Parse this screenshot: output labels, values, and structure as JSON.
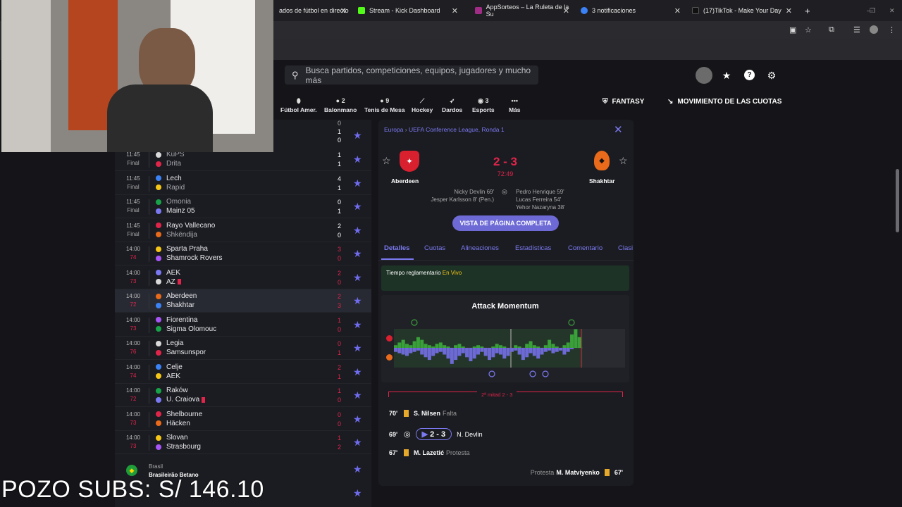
{
  "browser": {
    "tabs": [
      {
        "label": "ados de fútbol en directo",
        "color": "#1f1f23"
      },
      {
        "label": "Stream - Kick Dashboard",
        "color": "#53fc18"
      },
      {
        "label": "AppSorteos – La Ruleta de la Su",
        "color": "#a12c86"
      },
      {
        "label": "3 notificaciones",
        "color": "#3b82f6"
      },
      {
        "label": "(17)TikTok - Make Your Day",
        "color": "#111111"
      }
    ],
    "new_tab": "+"
  },
  "header": {
    "search_placeholder": "Busca partidos, competiciones, equipos, jugadores y mucho más",
    "sports": [
      {
        "label": "Fútbol Amer.",
        "count": ""
      },
      {
        "label": "Balonmano",
        "count": "2"
      },
      {
        "label": "Tenis de Mesa",
        "count": "9"
      },
      {
        "label": "Hockey",
        "count": ""
      },
      {
        "label": "Dardos",
        "count": ""
      },
      {
        "label": "Esports",
        "count": "3"
      },
      {
        "label": "Más",
        "count": ""
      }
    ],
    "fantasy": "FANTASY",
    "odds_movement": "MOVIMIENTO DE LAS CUOTAS"
  },
  "list": {
    "top_partial": {
      "home_score": "0",
      "score1": "1",
      "score2": "0"
    },
    "matches": [
      {
        "time": "11:45",
        "status": "Final",
        "live": false,
        "home": "KuPS",
        "away": "Drita",
        "hs": "1",
        "as": "1",
        "home_dim": true,
        "away_dim": true
      },
      {
        "time": "11:45",
        "status": "Final",
        "live": false,
        "home": "Lech",
        "away": "Rapid",
        "hs": "4",
        "as": "1",
        "home_dim": false,
        "away_dim": true
      },
      {
        "time": "11:45",
        "status": "Final",
        "live": false,
        "home": "Omonia",
        "away": "Mainz 05",
        "hs": "0",
        "as": "1",
        "home_dim": true,
        "away_dim": false
      },
      {
        "time": "11:45",
        "status": "Final",
        "live": false,
        "home": "Rayo Vallecano",
        "away": "Shkëndija",
        "hs": "2",
        "as": "0",
        "home_dim": false,
        "away_dim": true
      },
      {
        "time": "14:00",
        "status": "74",
        "live": true,
        "home": "Sparta Praha",
        "away": "Shamrock Rovers",
        "hs": "3",
        "as": "0",
        "home_dim": false,
        "away_dim": false
      },
      {
        "time": "14:00",
        "status": "73",
        "live": true,
        "home": "AEK",
        "away": "AZ",
        "hs": "2",
        "as": "0",
        "home_dim": false,
        "away_dim": false,
        "away_card": true
      },
      {
        "time": "14:00",
        "status": "72",
        "live": true,
        "home": "Aberdeen",
        "away": "Shakhtar",
        "hs": "2",
        "as": "3",
        "home_dim": false,
        "away_dim": false,
        "selected": true
      },
      {
        "time": "14:00",
        "status": "73",
        "live": true,
        "home": "Fiorentina",
        "away": "Sigma Olomouc",
        "hs": "1",
        "as": "0",
        "home_dim": false,
        "away_dim": false
      },
      {
        "time": "14:00",
        "status": "76",
        "live": true,
        "home": "Legia",
        "away": "Samsunspor",
        "hs": "0",
        "as": "1",
        "home_dim": false,
        "away_dim": false
      },
      {
        "time": "14:00",
        "status": "74",
        "live": true,
        "home": "Celje",
        "away": "AEK",
        "hs": "2",
        "as": "1",
        "home_dim": false,
        "away_dim": false
      },
      {
        "time": "14:00",
        "status": "72",
        "live": true,
        "home": "Raków",
        "away": "U. Craiova",
        "hs": "1",
        "as": "0",
        "home_dim": false,
        "away_dim": false,
        "away_card": true
      },
      {
        "time": "14:00",
        "status": "73",
        "live": true,
        "home": "Shelbourne",
        "away": "Häcken",
        "hs": "0",
        "as": "0",
        "home_dim": false,
        "away_dim": false
      },
      {
        "time": "14:00",
        "status": "73",
        "live": true,
        "home": "Slovan",
        "away": "Strasbourg",
        "hs": "1",
        "as": "2",
        "home_dim": false,
        "away_dim": false
      }
    ],
    "next_league": {
      "country": "Brasil",
      "name": "Brasileirão Betano"
    }
  },
  "detail": {
    "breadcrumb_region": "Europa",
    "breadcrumb_comp": "UEFA Conference League, Ronda 1",
    "home": "Aberdeen",
    "away": "Shakhtar",
    "score": "2 - 3",
    "clock": "72:49",
    "home_scorers": [
      "Nicky Devlin 69'",
      "Jesper Karlsson 8' (Pen.)"
    ],
    "away_scorers": [
      "Pedro Henrique 59'",
      "Lucas Ferreira 54'",
      "Yehor Nazaryna 38'"
    ],
    "full_page_button": "VISTA DE PÁGINA COMPLETA",
    "tabs": [
      "Detalles",
      "Cuotas",
      "Alineaciones",
      "Estadísticas",
      "Comentario",
      "Clasi"
    ],
    "status_label": "Tiempo reglamentario",
    "status_value": "En Vivo",
    "momentum_title": "Attack Momentum",
    "half_label": "2ª mitad 2 - 3",
    "events": [
      {
        "minute": "70'",
        "player": "S. Nilsen",
        "detail": "Falta",
        "type": "yellow"
      },
      {
        "minute": "69'",
        "player": "N. Devlin",
        "detail": "2 - 3",
        "type": "goal"
      },
      {
        "minute": "67'",
        "player": "M. Lazetić",
        "detail": "Protesta",
        "type": "yellow"
      }
    ],
    "away_event": {
      "minute": "67'",
      "player": "M. Matviyenko",
      "detail": "Protesta"
    }
  },
  "overlay": {
    "pozo": "POZO SUBS: S/ 146.10"
  },
  "colors": {
    "accent": "#7b79f2",
    "live": "#e0244a",
    "momentum_green": "#3aa03a",
    "momentum_purple": "#6d6ad6"
  }
}
